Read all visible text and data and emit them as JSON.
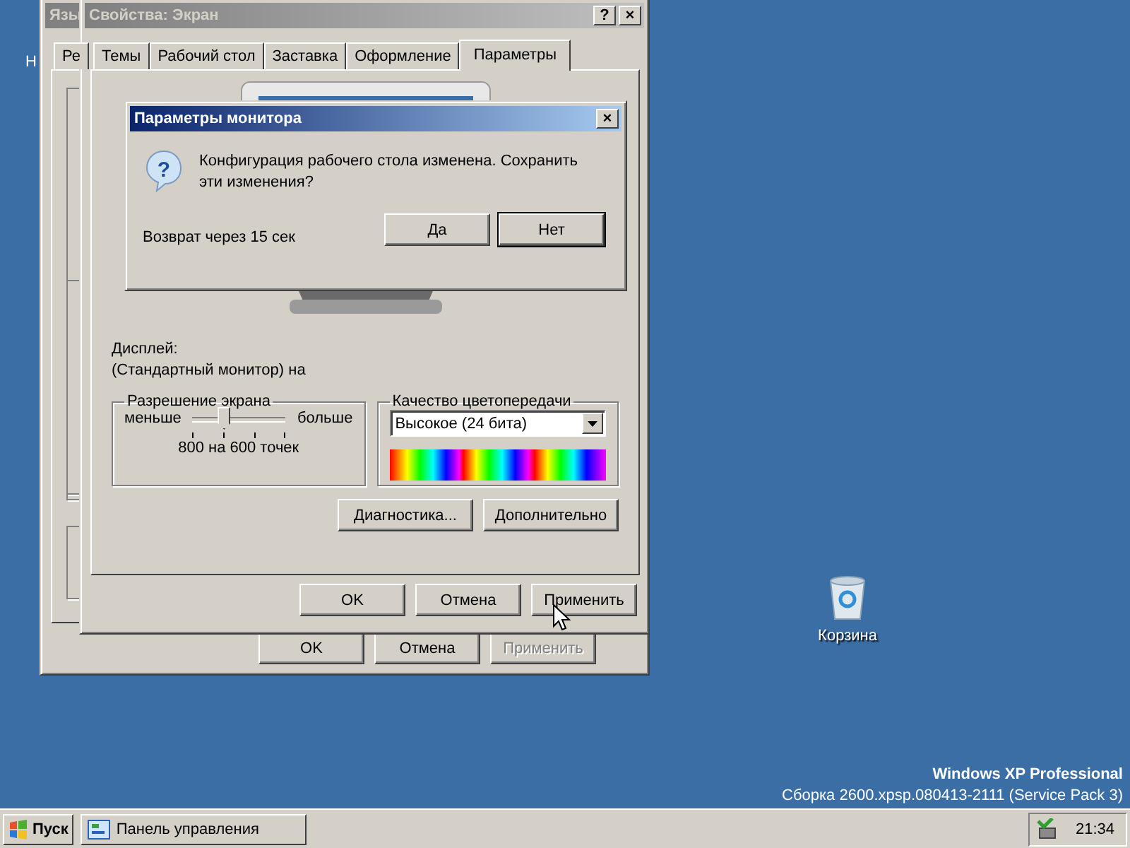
{
  "desktop": {
    "partial_icon_label": "Н",
    "recycle_bin_label": "Корзина",
    "edition": "Windows XP Professional",
    "build": "Сборка 2600.xpsp.080413-2111 (Service Pack 3)"
  },
  "back_window": {
    "title": "Язы",
    "tabs": [
      {
        "label": "Ре",
        "selected": false
      }
    ],
    "buttons": [
      {
        "label": "OK",
        "disabled": false
      },
      {
        "label": "Отмена",
        "disabled": false
      },
      {
        "label": "Применить",
        "disabled": true
      }
    ]
  },
  "window": {
    "title": "Свойства: Экран",
    "help_button": "?",
    "close_button": "×",
    "tabs": [
      {
        "label": "Темы",
        "selected": false
      },
      {
        "label": "Рабочий стол",
        "selected": false
      },
      {
        "label": "Заставка",
        "selected": false
      },
      {
        "label": "Оформление",
        "selected": false
      },
      {
        "label": "Параметры",
        "selected": true
      }
    ],
    "display_label": "Дисплей:",
    "display_value": "(Стандартный монитор) на",
    "resolution": {
      "title": "Разрешение экрана",
      "min_label": "меньше",
      "max_label": "больше",
      "level": 0.33,
      "value_text": "800 на 600 точек"
    },
    "color_quality": {
      "title": "Качество цветопередачи",
      "value": "Высокое (24 бита)"
    },
    "panel_buttons": [
      "Диагностика...",
      "Дополнительно"
    ],
    "buttons": [
      {
        "label": "OK",
        "disabled": false
      },
      {
        "label": "Отмена",
        "disabled": false
      },
      {
        "label": "Применить",
        "disabled": false
      }
    ]
  },
  "dialog": {
    "title": "Параметры монитора",
    "close_button": "×",
    "icon_glyph": "?",
    "message": "Конфигурация рабочего стола изменена. Сохранить эти изменения?",
    "countdown": "Возврат через 15 сек",
    "buttons": [
      {
        "label": "Да",
        "default": false
      },
      {
        "label": "Нет",
        "default": true
      }
    ]
  },
  "taskbar": {
    "start_label": "Пуск",
    "tasks": [
      {
        "label": "Панель управления",
        "selected": false
      }
    ],
    "clock": "21:34"
  }
}
